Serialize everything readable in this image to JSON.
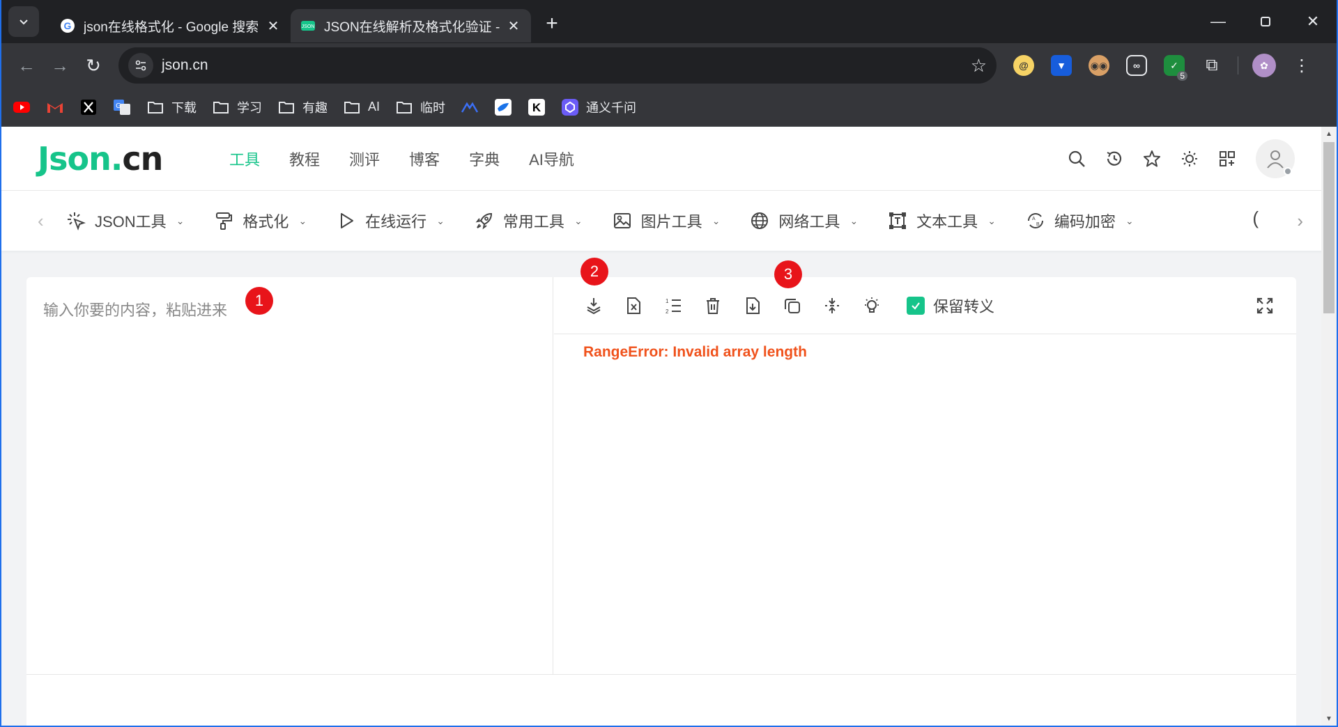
{
  "browser": {
    "tabs": [
      {
        "title": "json在线格式化 - Google 搜索",
        "active": false
      },
      {
        "title": "JSON在线解析及格式化验证 - J",
        "active": true
      }
    ],
    "url": "json.cn",
    "bookmarks": [
      {
        "label": "",
        "icon": "youtube-icon"
      },
      {
        "label": "",
        "icon": "gmail-icon"
      },
      {
        "label": "",
        "icon": "x-icon"
      },
      {
        "label": "",
        "icon": "translate-icon"
      },
      {
        "label": "下载",
        "icon": "folder-icon"
      },
      {
        "label": "学习",
        "icon": "folder-icon"
      },
      {
        "label": "有趣",
        "icon": "folder-icon"
      },
      {
        "label": "AI",
        "icon": "folder-icon"
      },
      {
        "label": "临时",
        "icon": "folder-icon"
      },
      {
        "label": "",
        "icon": "mountain-icon"
      },
      {
        "label": "",
        "icon": "bird-icon"
      },
      {
        "label": "",
        "icon": "k-icon"
      },
      {
        "label": "通义千问",
        "icon": "tongyi-icon"
      }
    ],
    "extension_badge": "5"
  },
  "site": {
    "logo_green": "Json",
    "logo_dot": ".",
    "logo_dark": "cn",
    "nav": [
      "工具",
      "教程",
      "测评",
      "博客",
      "字典",
      "AI导航"
    ],
    "active_nav": "工具",
    "categories": [
      {
        "label": "JSON工具",
        "icon": "sparkle-icon"
      },
      {
        "label": "格式化",
        "icon": "paint-roller-icon"
      },
      {
        "label": "在线运行",
        "icon": "play-icon"
      },
      {
        "label": "常用工具",
        "icon": "rocket-icon"
      },
      {
        "label": "图片工具",
        "icon": "image-icon"
      },
      {
        "label": "网络工具",
        "icon": "globe-icon"
      },
      {
        "label": "文本工具",
        "icon": "text-box-icon"
      },
      {
        "label": "编码加密",
        "icon": "encode-icon"
      }
    ],
    "partial_category": "(",
    "editor": {
      "placeholder": "输入你要的内容，粘贴进来",
      "keep_escape_label": "保留转义",
      "keep_escape_checked": true,
      "error": "RangeError: Invalid array length"
    },
    "markers": [
      "1",
      "2",
      "3"
    ]
  },
  "colors": {
    "accent": "#16c48a",
    "error": "#f0521c",
    "marker": "#e8141a"
  }
}
